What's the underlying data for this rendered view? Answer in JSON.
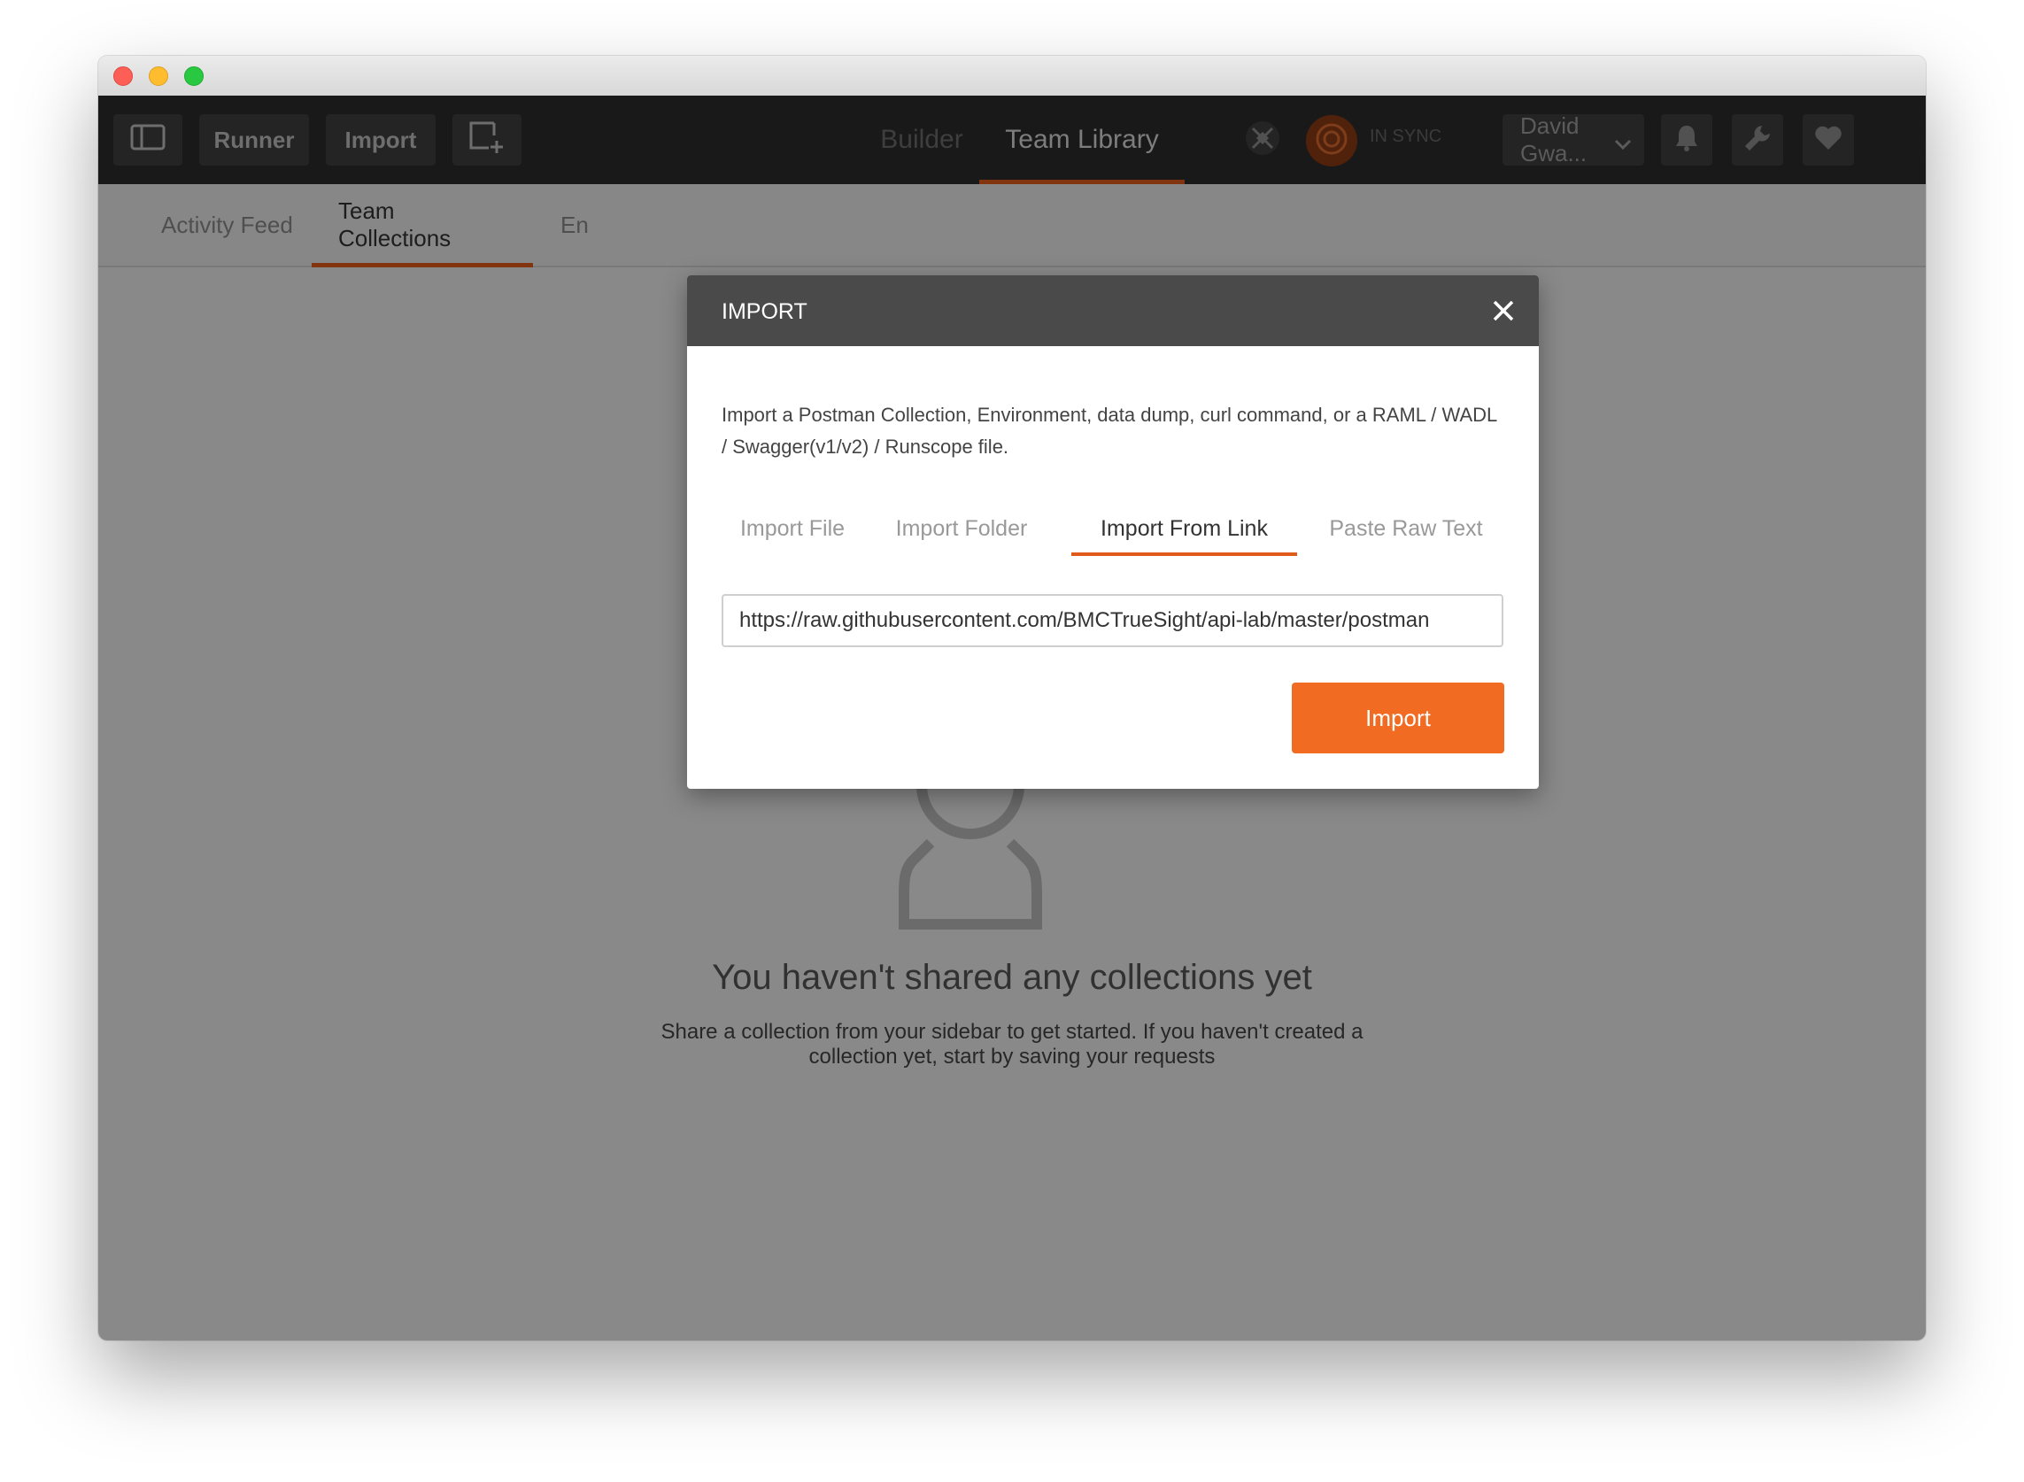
{
  "window": {
    "traffic_lights": [
      "close",
      "minimize",
      "maximize"
    ]
  },
  "toolbar": {
    "sidebar_toggle_icon": "sidebar-icon",
    "runner_label": "Runner",
    "import_label": "Import",
    "new_window_icon": "new-window-icon",
    "tabs": [
      {
        "label": "Builder",
        "active": false
      },
      {
        "label": "Team Library",
        "active": true
      }
    ],
    "interceptor_icon": "satellite-icon",
    "sync_icon": "sync-icon",
    "sync_status": "IN SYNC",
    "user_name": "David Gwa...",
    "bell_icon": "bell-icon",
    "settings_icon": "wrench-icon",
    "heart_icon": "heart-icon",
    "accent_color": "#e05a1a"
  },
  "library": {
    "tabs": [
      {
        "label": "Activity Feed",
        "active": false
      },
      {
        "label": "Team Collections",
        "active": true
      },
      {
        "label": "En",
        "active": false
      }
    ],
    "empty_icon": "person-icon",
    "empty_title": "You haven't shared any collections yet",
    "empty_subtitle": "Share a collection from your sidebar to get started. If you haven't created a collection yet, start by saving your requests"
  },
  "modal": {
    "title": "IMPORT",
    "close_icon": "close-icon",
    "description": "Import a Postman Collection, Environment, data dump, curl command, or a RAML / WADL / Swagger(v1/v2) / Runscope file.",
    "tabs": [
      {
        "label": "Import File",
        "active": false
      },
      {
        "label": "Import Folder",
        "active": false
      },
      {
        "label": "Import From Link",
        "active": true
      },
      {
        "label": "Paste Raw Text",
        "active": false
      }
    ],
    "url_value": "https://raw.githubusercontent.com/BMCTrueSight/api-lab/master/postman",
    "import_button": "Import",
    "button_color": "#f26b22"
  }
}
